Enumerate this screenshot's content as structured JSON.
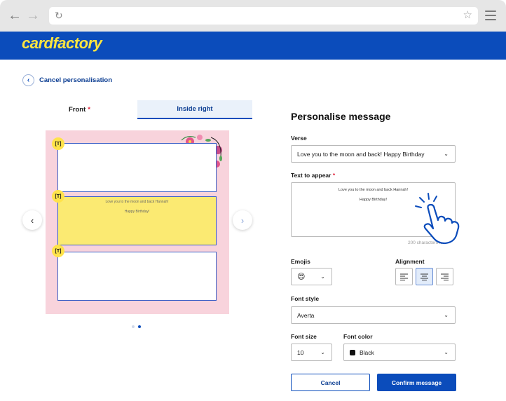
{
  "header": {
    "logo": "cardfactory"
  },
  "nav": {
    "cancel_label": "Cancel personalisation"
  },
  "tabs": [
    {
      "label": "Front",
      "required": "*"
    },
    {
      "label": "Inside right"
    }
  ],
  "card": {
    "box_badge": "[T]",
    "message_lines": [
      "Love you to the moon and back Hannah!",
      "Happy Birthday!"
    ]
  },
  "panel": {
    "title": "Personalise message",
    "verse_label": "Verse",
    "verse_value": "Love you to the moon and back! Happy Birthday",
    "text_label": "Text to appear",
    "text_required": "*",
    "text_lines": [
      "Love you to the moon and back Hannah!",
      "Happy Birthday!"
    ],
    "char_count": "200 characters left",
    "emojis_label": "Emojis",
    "emoji_value": "😍",
    "alignment_label": "Alignment",
    "font_style_label": "Font style",
    "font_style_value": "Averta",
    "font_size_label": "Font size",
    "font_size_value": "10",
    "font_color_label": "Font color",
    "font_color_value": "Black",
    "font_color_swatch": "#111111"
  },
  "actions": {
    "cancel": "Cancel",
    "confirm": "Confirm message"
  },
  "colors": {
    "brand_blue": "#0b4cbb",
    "brand_yellow": "#ffe53f",
    "card_pink": "#f8d3dc",
    "selected_box": "#fbea72"
  }
}
